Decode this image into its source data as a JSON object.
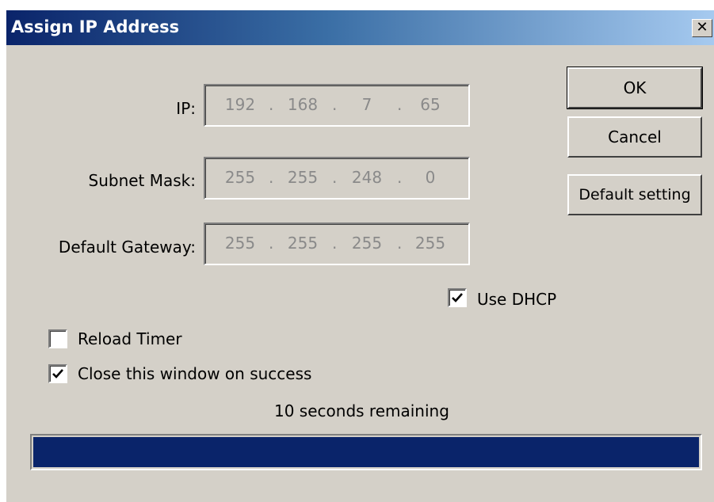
{
  "window": {
    "title": "Assign IP Address",
    "close_glyph": "✕"
  },
  "fields": {
    "ip": {
      "label": "IP:",
      "octets": [
        "192",
        "168",
        "7",
        "65"
      ]
    },
    "subnet": {
      "label": "Subnet Mask:",
      "octets": [
        "255",
        "255",
        "248",
        "0"
      ]
    },
    "gateway": {
      "label": "Default Gateway:",
      "octets": [
        "255",
        "255",
        "255",
        "255"
      ]
    },
    "separator": "."
  },
  "buttons": {
    "ok": "OK",
    "cancel": "Cancel",
    "default_setting": "Default setting"
  },
  "options": {
    "use_dhcp": {
      "label": "Use DHCP",
      "checked": true
    },
    "reload_timer": {
      "label": "Reload Timer",
      "checked": false
    },
    "close_on_success": {
      "label": "Close this window on success",
      "checked": true
    }
  },
  "status": {
    "countdown": "10 seconds remaining",
    "progress": 1.0
  },
  "colors": {
    "title_start": "#0a246a",
    "title_end": "#a6caf0",
    "dialog_bg": "#d4d0c8",
    "progress_fill": "#0a246a"
  }
}
